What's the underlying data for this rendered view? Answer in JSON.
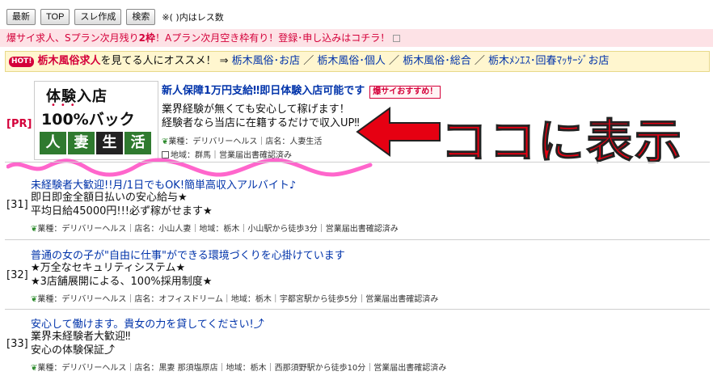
{
  "toolbar": {
    "buttons": [
      "最新",
      "TOP",
      "スレ作成",
      "検索"
    ],
    "note": "※( )内はレス数"
  },
  "promo": {
    "part1": "爆サイ求人、Sプラン次月残り",
    "count": "2枠",
    "part2": "！Aプラン次月空き枠有り！登録･申し込みはコチラ！"
  },
  "recommend": {
    "hot": "HOT!",
    "prefix": "栃木風俗求人",
    "mid": "を見てる人にオススメ！ ⇒ ",
    "links": [
      "栃木風俗･お店",
      "栃木風俗･個人",
      "栃木風俗･総合",
      "栃木ﾒﾝｴｽ･回春ﾏｯｻｰｼﾞお店"
    ]
  },
  "pr": {
    "label": "[PR]",
    "ad": {
      "line1": "体験入店",
      "line2": "100%バック",
      "tiles": [
        "人",
        "妻",
        "生",
        "活"
      ]
    },
    "title": "新人保障1万円支給‼即日体験入店可能です",
    "badge": "爆サイおすすめ！",
    "body1": "業界経験が無くても安心して稼げます！",
    "body2": "経験者なら当店に在籍するだけで収入UP‼",
    "meta1": "業種：デリバリーヘルス｜店名：人妻生活",
    "meta2": "地域：群馬｜営業届出書確認済み",
    "overlay": "ココに表示"
  },
  "posts": [
    {
      "num": "[31]",
      "title": "未経験者大歓迎!!月/1日でもOK!簡単高収入アルバイト♪",
      "body1": "即日即金全額日払いの安心給与★",
      "body2": "平均日給45000円!!!必ず稼がせます★",
      "meta": "業種：デリバリーヘルス｜店名：小山人妻｜地域：栃木｜小山駅から徒歩3分｜営業届出書確認済み"
    },
    {
      "num": "[32]",
      "title": "普通の女の子が\"自由に仕事\"ができる環境づくりを心掛けています",
      "body1": "★万全なセキュリティシステム★",
      "body2": "★3店舗展開による、100%採用制度★",
      "meta": "業種：デリバリーヘルス｜店名：オフィスドリーム｜地域：栃木｜宇都宮駅から徒歩5分｜営業届出書確認済み"
    },
    {
      "num": "[33]",
      "title": "安心して働けます。貴女の力を貸してください!⤴",
      "body1": "業界未経験者大歓迎‼",
      "body2": "安心の体験保証⤴",
      "meta": "業種：デリバリーヘルス｜店名：黒妻 那須塩原店｜地域：栃木｜西那須野駅から徒歩10分｜営業届出書確認済み"
    }
  ],
  "colors": {
    "accent": "#d4003a",
    "link": "#0033aa",
    "promo_bg": "#fde2e6",
    "reco_bg": "#fff6cf"
  }
}
